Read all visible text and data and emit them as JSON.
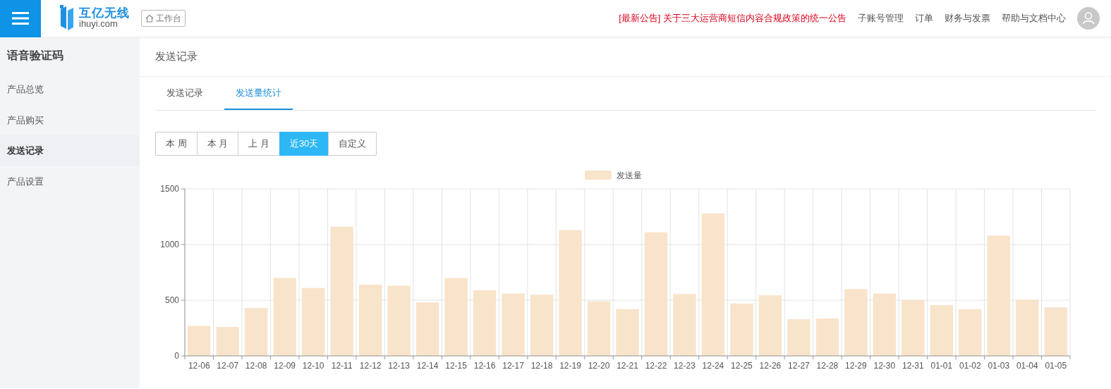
{
  "header": {
    "brand": {
      "name": "互亿无线",
      "domain": "ihuyi.com"
    },
    "workbench_button": "工作台",
    "notice": "[最新公告] 关于三大运营商短信内容合规政策的统一公告",
    "nav_links": [
      "子账号管理",
      "订单",
      "财务与发票",
      "帮助与文档中心"
    ]
  },
  "sidebar": {
    "title": "语音验证码",
    "items": [
      {
        "label": "产品总览",
        "selected": false
      },
      {
        "label": "产品购买",
        "selected": false
      },
      {
        "label": "发送记录",
        "selected": true
      },
      {
        "label": "产品设置",
        "selected": false
      }
    ]
  },
  "page_title": "发送记录",
  "tabs": [
    {
      "label": "发送记录",
      "selected": false
    },
    {
      "label": "发送量统计",
      "selected": true
    }
  ],
  "range_buttons": [
    {
      "label": "本 周",
      "selected": false
    },
    {
      "label": "本 月",
      "selected": false
    },
    {
      "label": "上 月",
      "selected": false
    },
    {
      "label": "近30天",
      "selected": true
    },
    {
      "label": "自定义",
      "selected": false
    }
  ],
  "chart": {
    "chart_data": {
      "type": "bar",
      "categories": [
        "12-06",
        "12-07",
        "12-08",
        "12-09",
        "12-10",
        "12-11",
        "12-12",
        "12-13",
        "12-14",
        "12-15",
        "12-16",
        "12-17",
        "12-18",
        "12-19",
        "12-20",
        "12-21",
        "12-22",
        "12-23",
        "12-24",
        "12-25",
        "12-26",
        "12-27",
        "12-28",
        "12-29",
        "12-30",
        "12-31",
        "01-01",
        "01-02",
        "01-03",
        "01-04",
        "01-05"
      ],
      "series": [
        {
          "name": "发送量",
          "color": "#f8e4ca",
          "values": [
            270,
            260,
            430,
            700,
            610,
            1160,
            640,
            630,
            480,
            700,
            590,
            560,
            550,
            1130,
            490,
            420,
            1110,
            555,
            1280,
            470,
            545,
            330,
            335,
            600,
            560,
            500,
            455,
            420,
            1080,
            505,
            435
          ]
        }
      ],
      "ylim": [
        0,
        1500
      ],
      "yticks": [
        0,
        500,
        1000,
        1500
      ]
    }
  }
}
